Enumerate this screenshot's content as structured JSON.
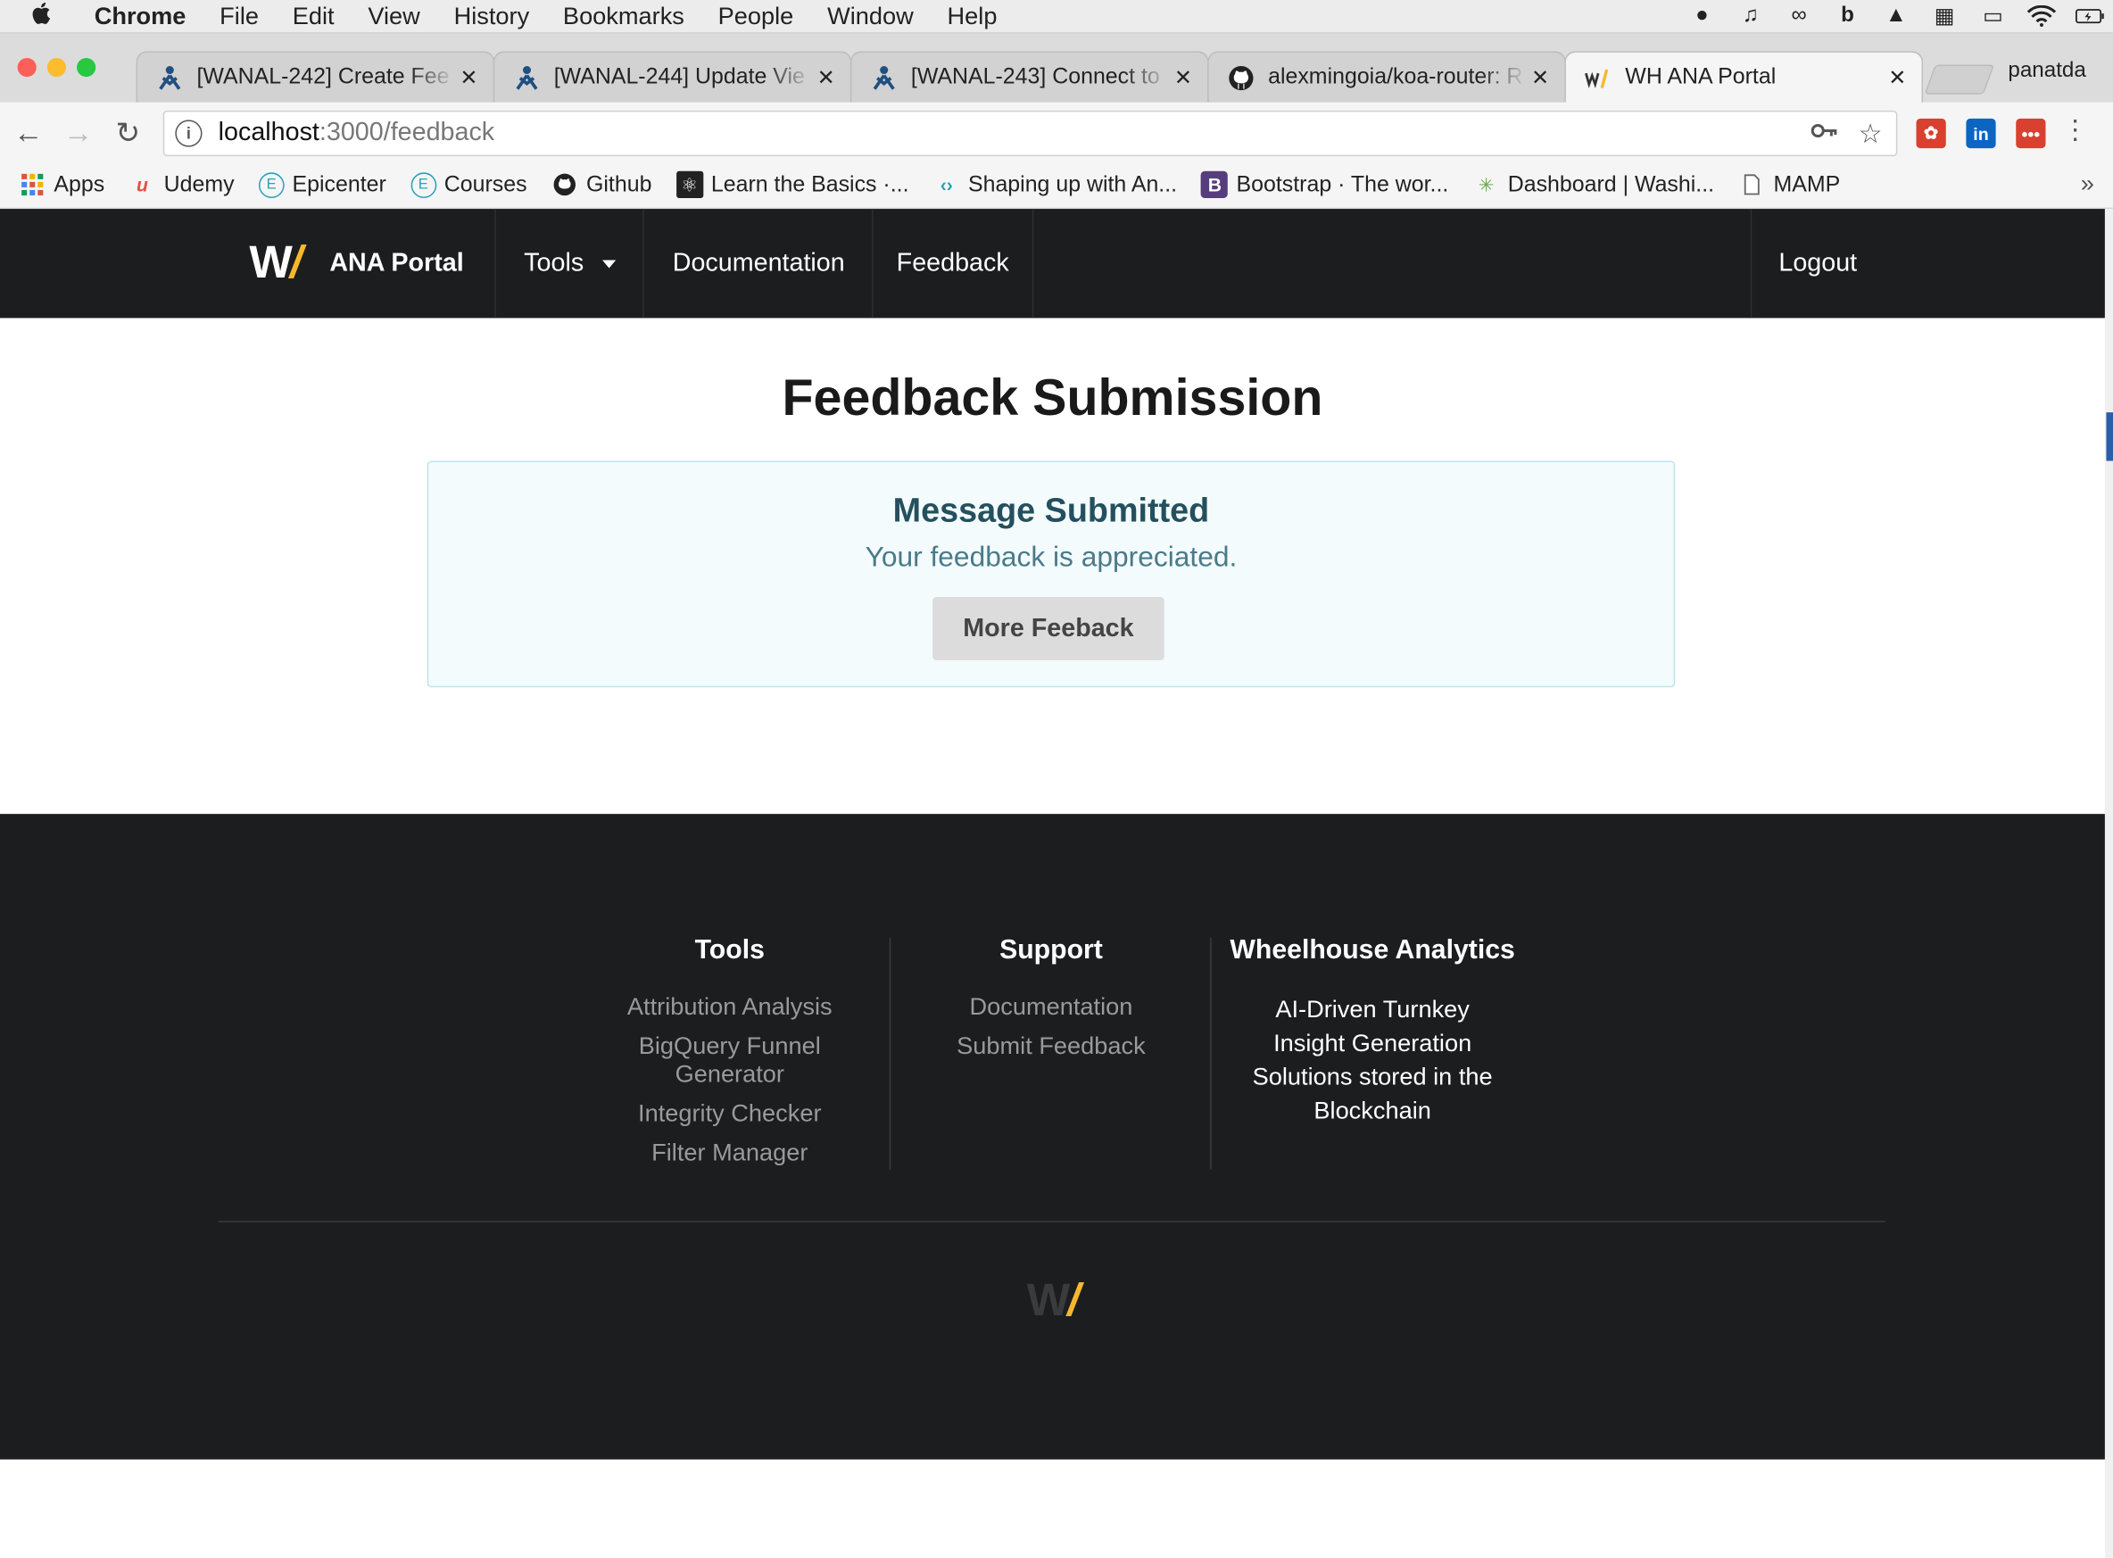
{
  "menubar": {
    "app": "Chrome",
    "items": [
      "File",
      "Edit",
      "View",
      "History",
      "Bookmarks",
      "People",
      "Window",
      "Help"
    ]
  },
  "tabs": [
    {
      "label": "[WANAL-242] Create Fee",
      "icon": "jira-icon"
    },
    {
      "label": "[WANAL-244] Update Vie",
      "icon": "jira-icon"
    },
    {
      "label": "[WANAL-243] Connect to",
      "icon": "jira-icon"
    },
    {
      "label": "alexmingoia/koa-router: R",
      "icon": "github-icon"
    },
    {
      "label": "WH ANA Portal",
      "icon": "wh-logo-icon"
    }
  ],
  "profile": "panatda",
  "address": {
    "host": "localhost",
    "path": ":3000/feedback"
  },
  "bookmarks": [
    {
      "label": "Apps",
      "icon": "apps-grid-icon"
    },
    {
      "label": "Udemy",
      "icon": "udemy-icon"
    },
    {
      "label": "Epicenter",
      "icon": "epicenter-icon"
    },
    {
      "label": "Courses",
      "icon": "epicenter-icon"
    },
    {
      "label": "Github",
      "icon": "github-icon"
    },
    {
      "label": "Learn the Basics ·...",
      "icon": "react-icon"
    },
    {
      "label": "Shaping up with An...",
      "icon": "code-icon"
    },
    {
      "label": "Bootstrap · The wor...",
      "icon": "bootstrap-icon"
    },
    {
      "label": "Dashboard | Washi...",
      "icon": "spark-icon"
    },
    {
      "label": "MAMP",
      "icon": "page-icon"
    }
  ],
  "navbar": {
    "brand_logo_w": "W",
    "brand_logo_slash": "/",
    "brand_name": "ANA Portal",
    "tools": "Tools",
    "documentation": "Documentation",
    "feedback": "Feedback",
    "logout": "Logout"
  },
  "main": {
    "title": "Feedback Submission",
    "alert_heading": "Message Submitted",
    "alert_body": "Your feedback is appreciated.",
    "button": "More Feeback"
  },
  "footer": {
    "tools_heading": "Tools",
    "tools_links": [
      "Attribution Analysis",
      "BigQuery Funnel Generator",
      "Integrity Checker",
      "Filter Manager"
    ],
    "support_heading": "Support",
    "support_links": [
      "Documentation",
      "Submit Feedback"
    ],
    "company_heading": "Wheelhouse Analytics",
    "company_text": "AI-Driven Turnkey Insight Generation Solutions stored in the Blockchain",
    "logo_w": "W",
    "logo_slash": "/"
  },
  "colors": {
    "navbar_bg": "#1c1d1f",
    "accent": "#f5b82e",
    "alert_bg": "#f4fbfd",
    "alert_border": "#bfe3ec",
    "alert_heading": "#24505e"
  }
}
